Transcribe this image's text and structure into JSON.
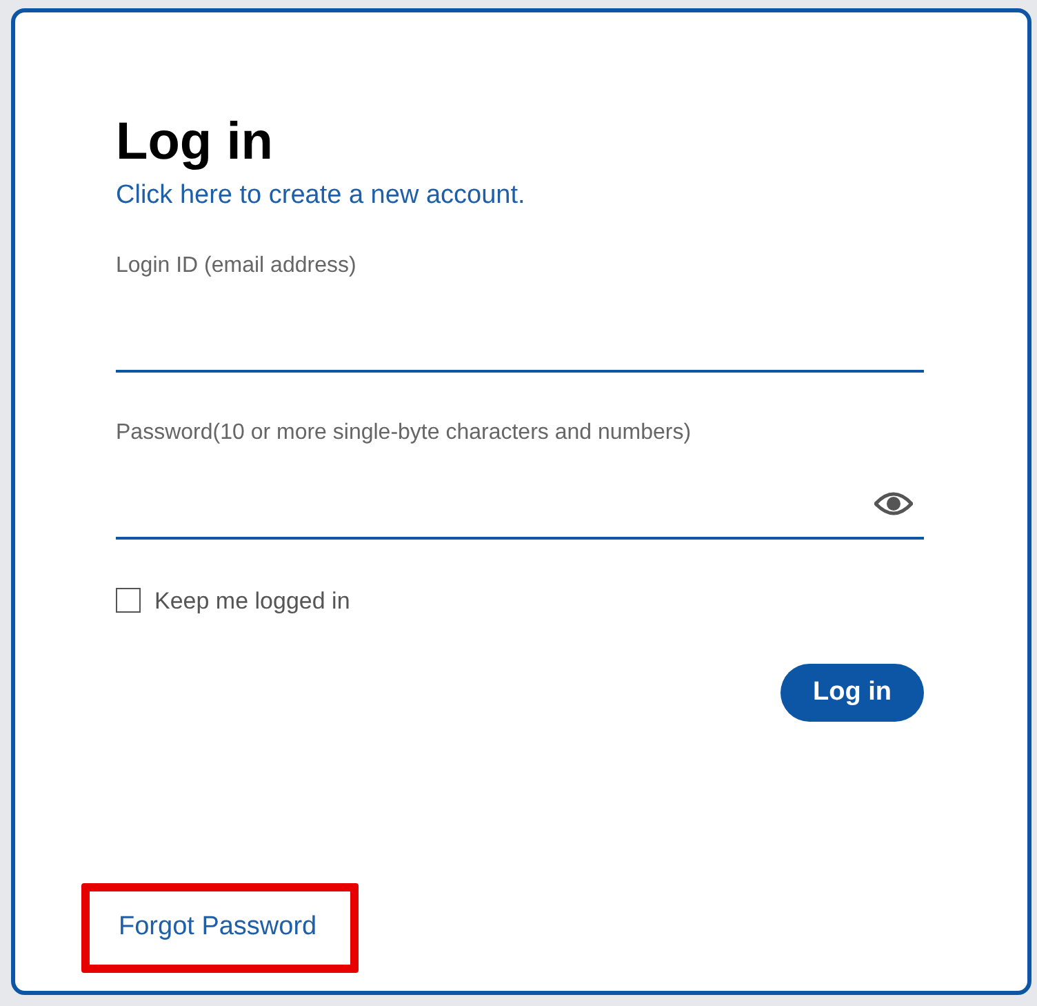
{
  "title": "Log in",
  "create_account_link": "Click here to create a new account.",
  "fields": [
    {
      "label": "Login ID (email address)",
      "kind": "text"
    },
    {
      "label": "Password(10 or more single-byte characters and numbers)",
      "kind": "password"
    }
  ],
  "keep_logged_in": {
    "label": "Keep me logged in",
    "checked": false
  },
  "login_button": "Log in",
  "forgot_password": {
    "label": "Forgot Password",
    "highlighted": true
  }
}
